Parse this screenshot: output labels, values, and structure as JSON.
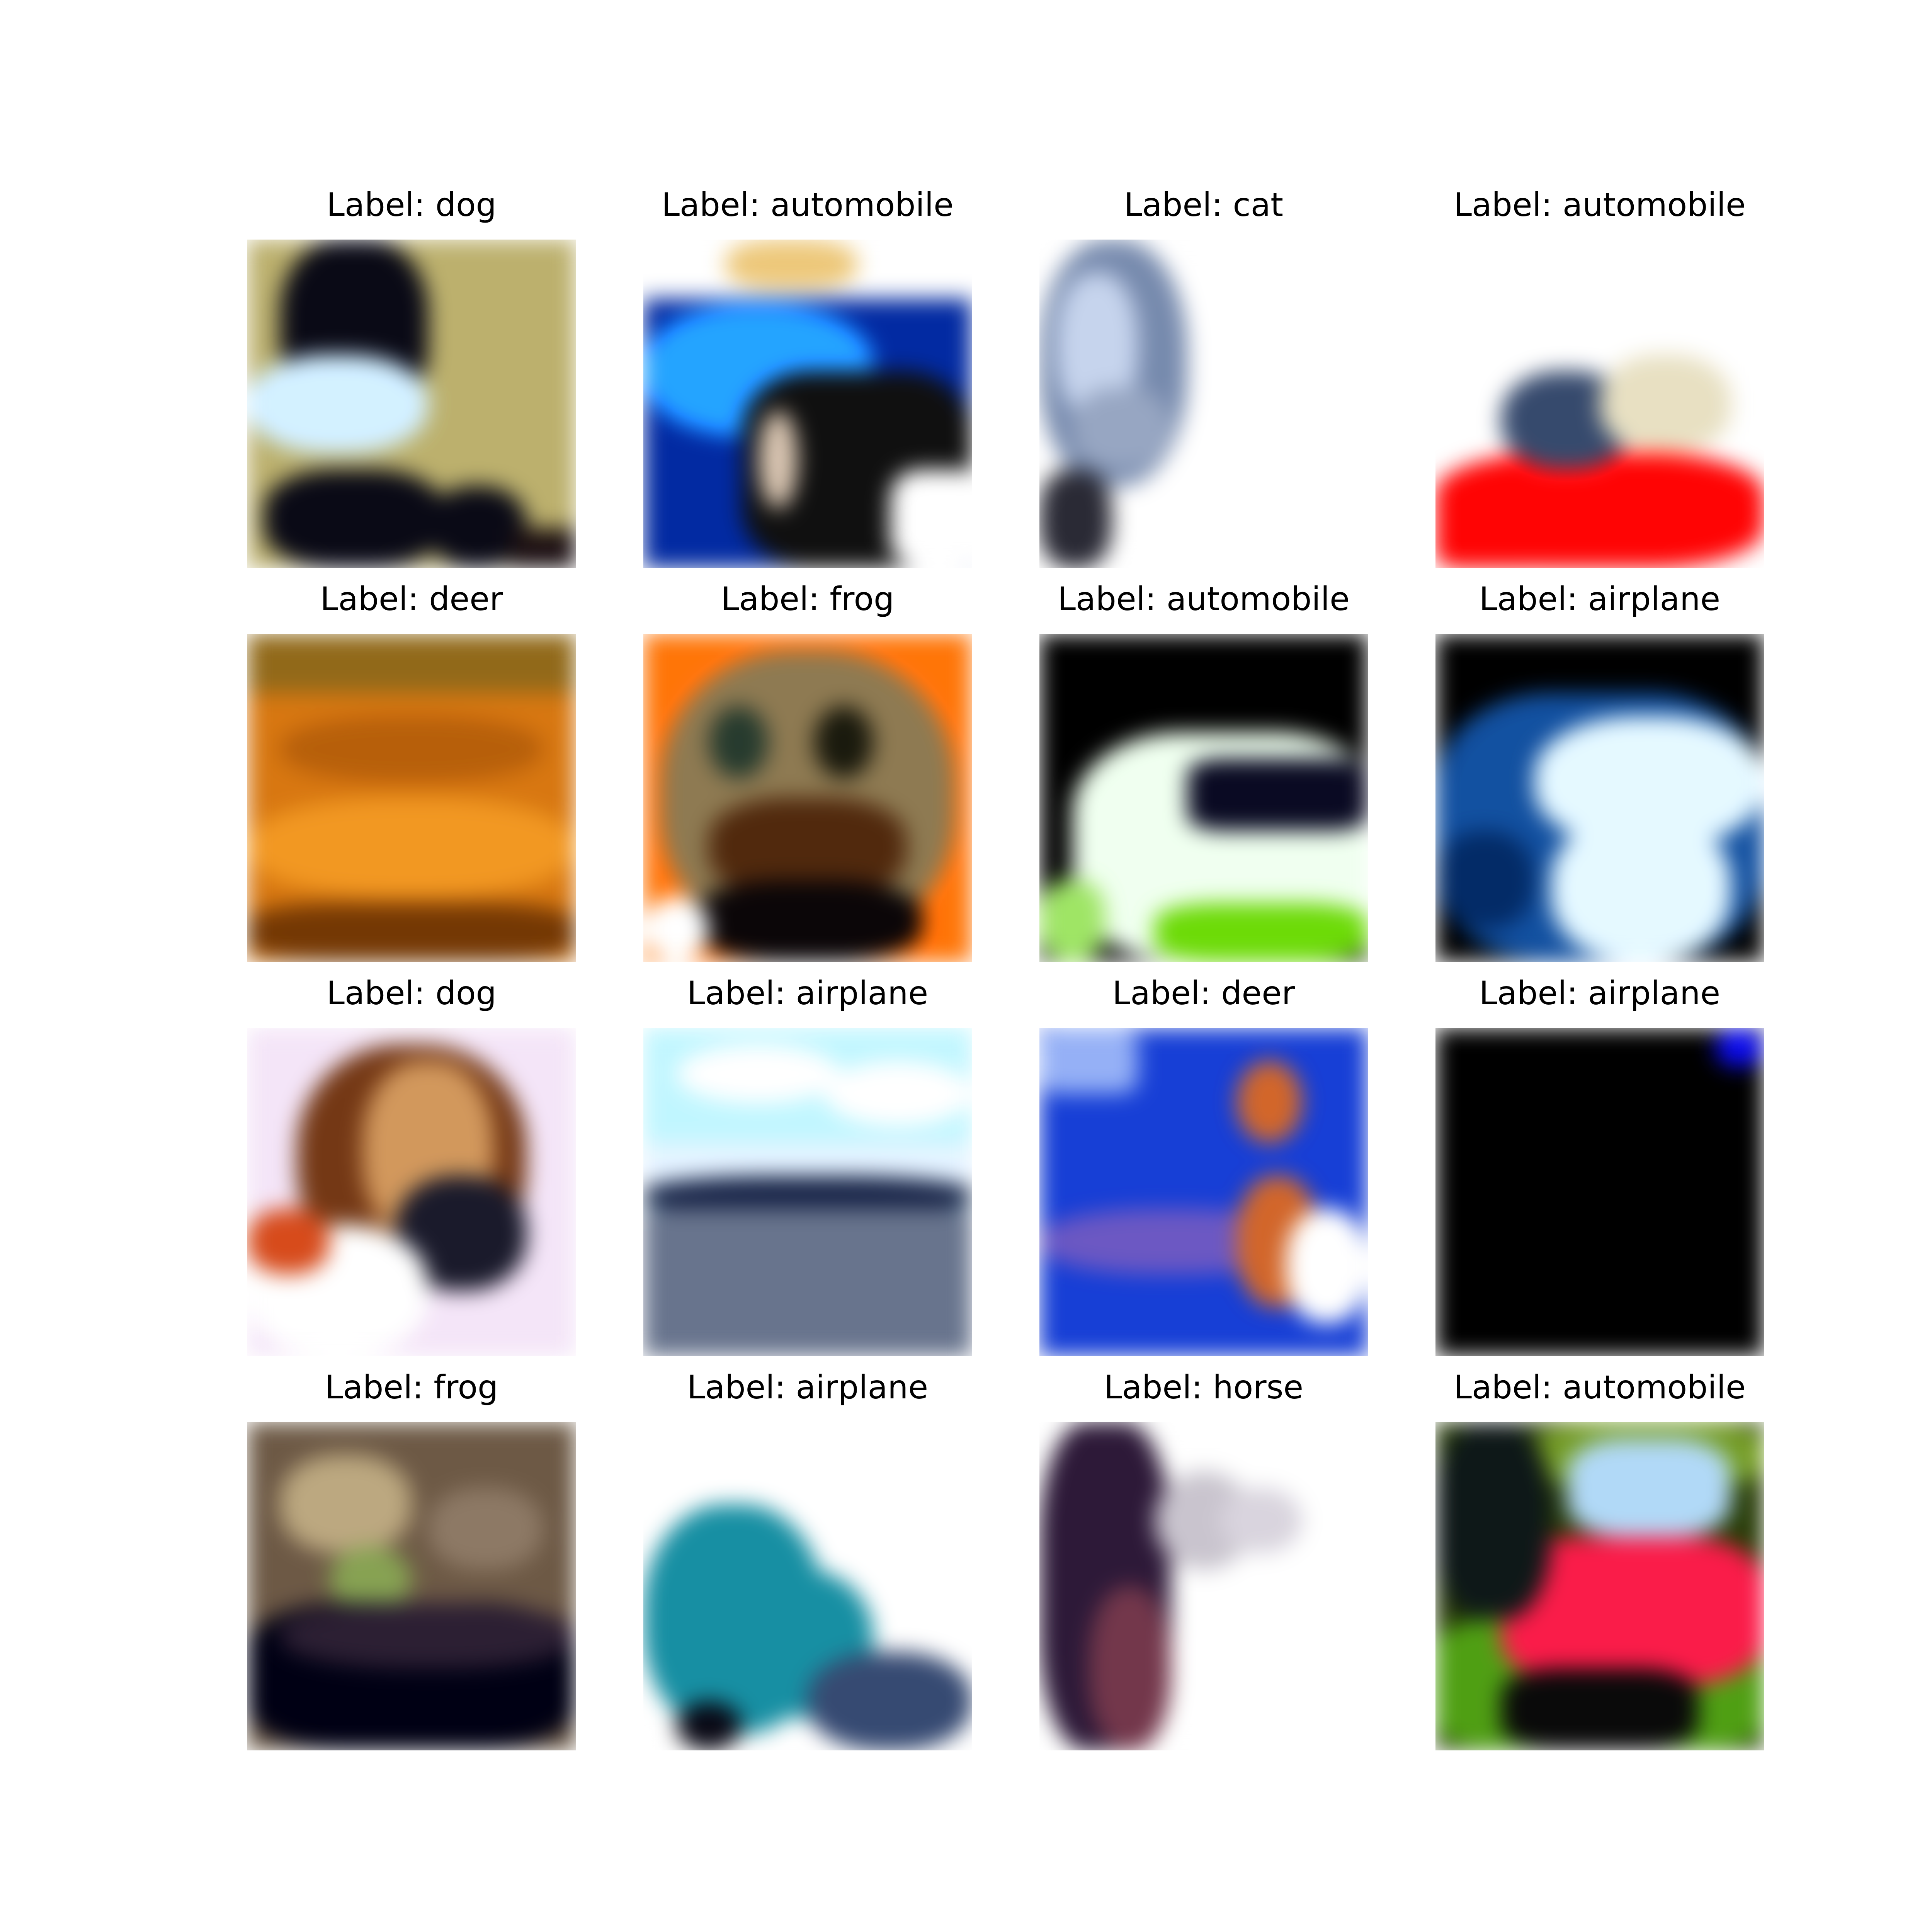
{
  "figure": {
    "panels": [
      {
        "label": "Label: dog",
        "colors": {
          "bg": "#b9b07a",
          "main": "#0a0a14",
          "accent": "#d8f0ff",
          "extra": "#1a1012"
        }
      },
      {
        "label": "Label: automobile",
        "colors": {
          "bg": "#ffffff",
          "main": "#0a2a8a",
          "accent": "#3aa0ff",
          "extra": "#101010"
        }
      },
      {
        "label": "Label: cat",
        "colors": {
          "bg": "#ffffff",
          "main": "#7a8aa6",
          "accent": "#2a2a33",
          "extra": "#c9d4e8"
        }
      },
      {
        "label": "Label: automobile",
        "colors": {
          "bg": "#ffffff",
          "main": "#ee1010",
          "accent": "#3a4a66",
          "extra": "#e6e0c8"
        }
      },
      {
        "label": "Label: deer",
        "colors": {
          "bg": "#c77a28",
          "main": "#a8621e",
          "accent": "#e29a3c",
          "extra": "#6a3a10"
        }
      },
      {
        "label": "Label: frog",
        "colors": {
          "bg": "#f27a22",
          "main": "#8a7a5a",
          "accent": "#4a2a14",
          "extra": "#ffffff"
        }
      },
      {
        "label": "Label: automobile",
        "colors": {
          "bg": "#000000",
          "main": "#f2fff2",
          "accent": "#7bd32a",
          "extra": "#0a0a1e"
        }
      },
      {
        "label": "Label: airplane",
        "colors": {
          "bg": "#000000",
          "main": "#1d4f8f",
          "accent": "#e8f8ff",
          "extra": "#3c7fc6"
        }
      },
      {
        "label": "Label: dog",
        "colors": {
          "bg": "#f2e6f5",
          "main": "#6a3a1e",
          "accent": "#ffffff",
          "extra": "#1a1a28"
        }
      },
      {
        "label": "Label: airplane",
        "colors": {
          "bg": "#c9f4ff",
          "main": "#1a2440",
          "accent": "#6a7488",
          "extra": "#ffffff"
        }
      },
      {
        "label": "Label: deer",
        "colors": {
          "bg": "#1f3fb8",
          "main": "#6a5ab0",
          "accent": "#ffffff",
          "extra": "#c06a3a"
        }
      },
      {
        "label": "Label: airplane",
        "colors": {
          "bg": "#000000",
          "main": "#000000",
          "accent": "#1010c8",
          "extra": "#000000"
        }
      },
      {
        "label": "Label: frog",
        "colors": {
          "bg": "#6a5a4a",
          "main": "#000010",
          "accent": "#8aa060",
          "extra": "#2a2030"
        }
      },
      {
        "label": "Label: airplane",
        "colors": {
          "bg": "#ffffff",
          "main": "#2a8a9a",
          "accent": "#3a4a6a",
          "extra": "#ffffff"
        }
      },
      {
        "label": "Label: horse",
        "colors": {
          "bg": "#ffffff",
          "main": "#2a1a33",
          "accent": "#c8c4cc",
          "extra": "#6a3a4a"
        }
      },
      {
        "label": "Label: automobile",
        "colors": {
          "bg": "#2a3a10",
          "main": "#d8264a",
          "accent": "#5a9a2a",
          "extra": "#b8d8f0"
        }
      }
    ]
  }
}
